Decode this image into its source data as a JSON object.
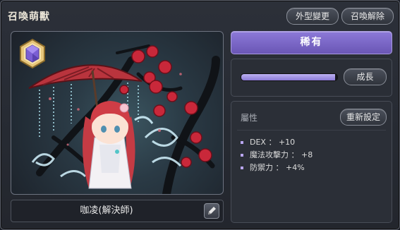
{
  "window": {
    "title": "召喚萌獸"
  },
  "header_buttons": {
    "appearance_label": "外型變更",
    "unsummon_label": "召喚解除"
  },
  "pet": {
    "name": "咖凌(解決師)",
    "rarity_label": "稀有",
    "rank_badge_icon": "purple-gem-hexagon-icon",
    "edit_icon": "pencil-icon"
  },
  "growth": {
    "button_label": "成長",
    "progress_fraction": 0.98
  },
  "stats": {
    "section_label": "屬性",
    "reset_label": "重新設定",
    "lines": [
      "DEX ： +10",
      "魔法攻擊力 ： +8",
      "防禦力 ： +4%"
    ]
  },
  "colors": {
    "rarity_purple": "#7a67c8",
    "bullet_purple": "#b9a6f0"
  }
}
